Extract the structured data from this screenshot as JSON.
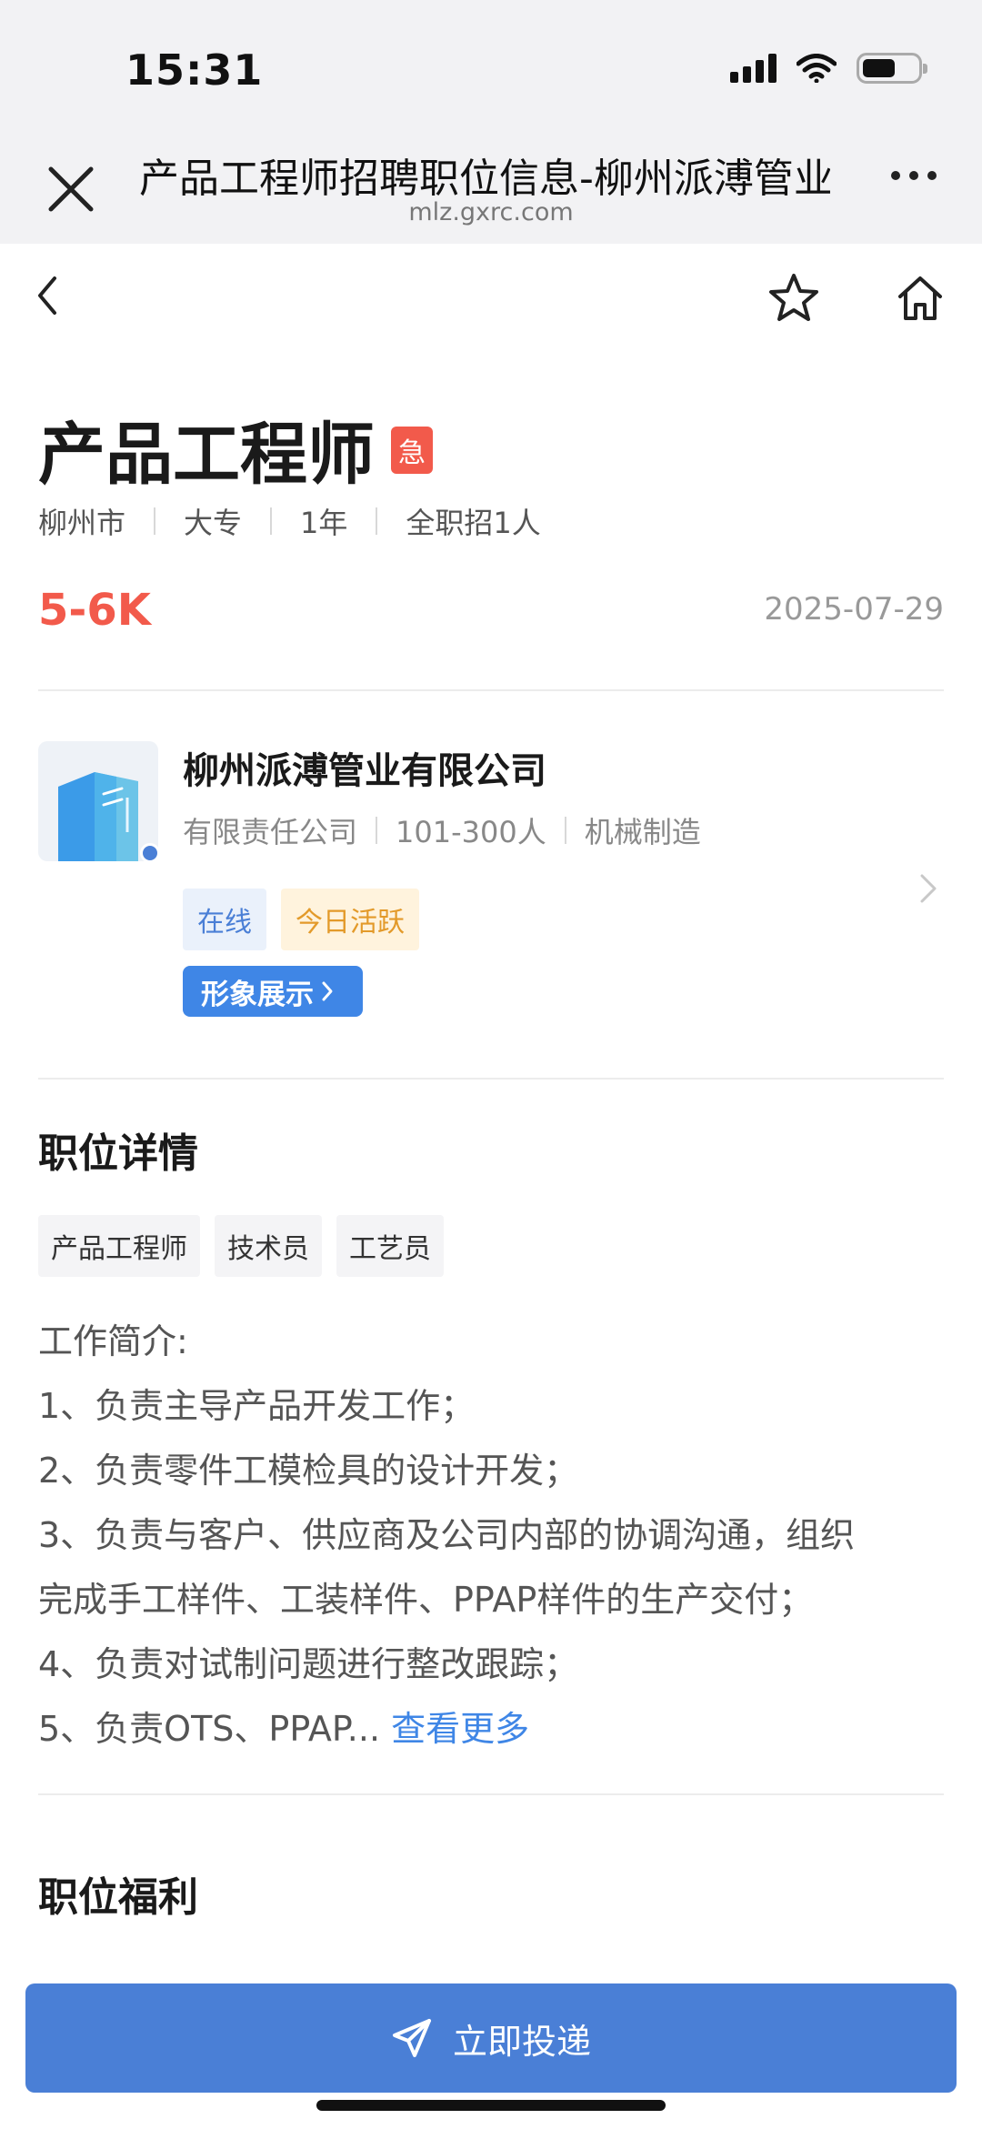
{
  "status_bar": {
    "time": "15:31"
  },
  "browser": {
    "page_title": "产品工程师招聘职位信息-柳州派溥管业有限公司",
    "domain": "mlz.gxrc.com"
  },
  "job": {
    "title": "产品工程师",
    "urgent_badge": "急",
    "meta": [
      "柳州市",
      "大专",
      "1年",
      "全职招1人"
    ],
    "salary": "5-6K",
    "post_date": "2025-07-29"
  },
  "company": {
    "name": "柳州派溥管业有限公司",
    "meta": [
      "有限责任公司",
      "101-300人",
      "机械制造"
    ],
    "tags": {
      "online": "在线",
      "active": "今日活跃"
    },
    "showcase_label": "形象展示"
  },
  "details": {
    "section_title": "职位详情",
    "skill_tags": [
      "产品工程师",
      "技术员",
      "工艺员"
    ],
    "description_lines": [
      "工作简介:",
      "1、负责主导产品开发工作；",
      "2、负责零件工模检具的设计开发；",
      "3、负责与客户、供应商及公司内部的协调沟通，组织",
      "完成手工样件、工装样件、PPAP样件的生产交付；",
      "4、负责对试制问题进行整改跟踪；"
    ],
    "last_line_prefix": "5、负责OTS、PPAP... ",
    "see_more": "查看更多"
  },
  "benefits": {
    "section_title": "职位福利"
  },
  "apply_button": {
    "label": "立即投递"
  },
  "colors": {
    "accent": "#4a7fd6",
    "salary": "#f25a4b",
    "urgent": "#f25a4b"
  }
}
